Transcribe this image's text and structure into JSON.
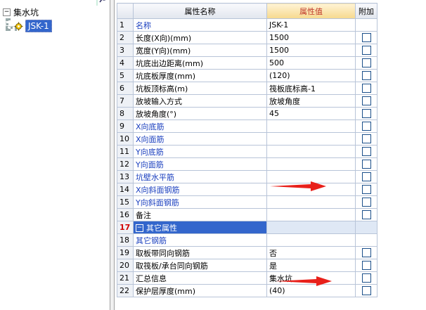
{
  "tree": {
    "root_label": "集水坑",
    "root_expand_glyph": "−",
    "child_label": "JSK-1"
  },
  "grid": {
    "headers": {
      "name": "属性名称",
      "value": "属性值",
      "extra": "附加"
    },
    "rows": [
      {
        "num": "1",
        "name": "名称",
        "value": "JSK-1",
        "blue": true,
        "checkbox": false
      },
      {
        "num": "2",
        "name": "长度(X向)(mm)",
        "value": "1500",
        "blue": false,
        "checkbox": true
      },
      {
        "num": "3",
        "name": "宽度(Y向)(mm)",
        "value": "1500",
        "blue": false,
        "checkbox": true
      },
      {
        "num": "4",
        "name": "坑底出边距离(mm)",
        "value": "500",
        "blue": false,
        "checkbox": true
      },
      {
        "num": "5",
        "name": "坑底板厚度(mm)",
        "value": "(120)",
        "blue": false,
        "checkbox": true
      },
      {
        "num": "6",
        "name": "坑板顶标高(m)",
        "value": "筏板底标高-1",
        "blue": false,
        "checkbox": true
      },
      {
        "num": "7",
        "name": "放坡输入方式",
        "value": "放坡角度",
        "blue": false,
        "checkbox": true
      },
      {
        "num": "8",
        "name": "放坡角度(°)",
        "value": "45",
        "blue": false,
        "checkbox": true
      },
      {
        "num": "9",
        "name": "X向底筋",
        "value": "",
        "blue": true,
        "checkbox": true
      },
      {
        "num": "10",
        "name": "X向面筋",
        "value": "",
        "blue": true,
        "checkbox": true
      },
      {
        "num": "11",
        "name": "Y向底筋",
        "value": "",
        "blue": true,
        "checkbox": true
      },
      {
        "num": "12",
        "name": "Y向面筋",
        "value": "",
        "blue": true,
        "checkbox": true
      },
      {
        "num": "13",
        "name": "坑壁水平筋",
        "value": "",
        "blue": true,
        "checkbox": true
      },
      {
        "num": "14",
        "name": "X向斜面钢筋",
        "value": "",
        "blue": true,
        "checkbox": true
      },
      {
        "num": "15",
        "name": "Y向斜面钢筋",
        "value": "",
        "blue": true,
        "checkbox": true
      },
      {
        "num": "16",
        "name": "备注",
        "value": "",
        "blue": false,
        "checkbox": true
      },
      {
        "num": "17",
        "name": "其它属性",
        "value": "",
        "group": true,
        "checkbox": false
      },
      {
        "num": "18",
        "name": "其它钢筋",
        "value": "",
        "blue": true,
        "indent": true,
        "checkbox": false
      },
      {
        "num": "19",
        "name": "取板带同向钢筋",
        "value": "否",
        "blue": false,
        "indent": true,
        "checkbox": true
      },
      {
        "num": "20",
        "name": "取筏板/承台同向钢筋",
        "value": "是",
        "blue": false,
        "indent": true,
        "checkbox": true
      },
      {
        "num": "21",
        "name": "汇总信息",
        "value": "集水坑",
        "blue": false,
        "indent": true,
        "checkbox": true
      },
      {
        "num": "22",
        "name": "保护层厚度(mm)",
        "value": "(40)",
        "blue": false,
        "indent": true,
        "checkbox": true
      }
    ]
  },
  "colors": {
    "arrow": "#e8201a",
    "selection": "#3366cc",
    "value_header": "#c0392b"
  },
  "icons": {
    "search": "search-icon",
    "tree_item": "gear-icon",
    "arrow": "red-arrow-icon"
  }
}
